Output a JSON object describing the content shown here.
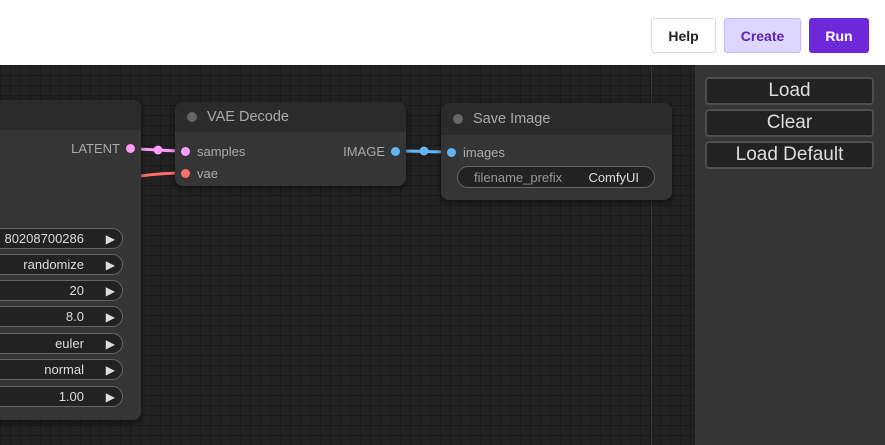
{
  "toolbar": {
    "help_label": "Help",
    "create_label": "Create",
    "run_label": "Run"
  },
  "sampler_node": {
    "output_latent": "LATENT",
    "widgets": [
      {
        "value": "80208700286"
      },
      {
        "value": "randomize"
      },
      {
        "value": "20"
      },
      {
        "value": "8.0"
      },
      {
        "value": "euler"
      },
      {
        "value": "normal"
      },
      {
        "value": "1.00"
      }
    ]
  },
  "vae_decode_node": {
    "title": "VAE Decode",
    "input_samples": "samples",
    "input_vae": "vae",
    "output_image": "IMAGE"
  },
  "save_image_node": {
    "title": "Save Image",
    "input_images": "images",
    "prefix_label": "filename_prefix",
    "prefix_value": "ComfyUI"
  },
  "side_panel": {
    "load_label": "Load",
    "clear_label": "Clear",
    "load_default_label": "Load Default"
  },
  "colors": {
    "latent_link": "#ff9cf9",
    "vae_link": "#ff6e6e",
    "image_link": "#64b5f6",
    "run_accent": "#6d28d9"
  },
  "arrow_glyph": "▶"
}
